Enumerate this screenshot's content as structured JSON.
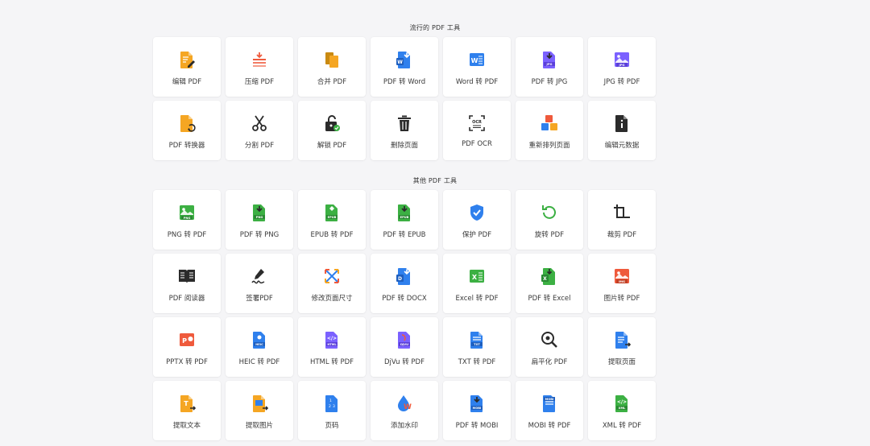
{
  "popular": {
    "title": "流行的 PDF 工具",
    "tools": [
      {
        "label": "编辑 PDF",
        "icon": "edit-pdf-icon"
      },
      {
        "label": "压缩 PDF",
        "icon": "compress-icon"
      },
      {
        "label": "合并 PDF",
        "icon": "merge-icon"
      },
      {
        "label": "PDF 转 Word",
        "icon": "word-download-icon"
      },
      {
        "label": "Word 转 PDF",
        "icon": "word-doc-icon"
      },
      {
        "label": "PDF 转 JPG",
        "icon": "jpg-download-icon"
      },
      {
        "label": "JPG 转 PDF",
        "icon": "jpg-image-icon"
      },
      {
        "label": "PDF 转换器",
        "icon": "convert-icon"
      },
      {
        "label": "分割 PDF",
        "icon": "scissors-icon"
      },
      {
        "label": "解锁 PDF",
        "icon": "unlock-icon"
      },
      {
        "label": "删除页面",
        "icon": "trash-icon"
      },
      {
        "label": "PDF OCR",
        "icon": "ocr-icon"
      },
      {
        "label": "重新排列页面",
        "icon": "rearrange-icon"
      },
      {
        "label": "编辑元数据",
        "icon": "info-file-icon"
      }
    ]
  },
  "other": {
    "title": "其他 PDF 工具",
    "tools": [
      {
        "label": "PNG 转 PDF",
        "icon": "png-image-icon"
      },
      {
        "label": "PDF 转 PNG",
        "icon": "png-download-icon"
      },
      {
        "label": "EPUB 转 PDF",
        "icon": "epub-icon"
      },
      {
        "label": "PDF 转 EPUB",
        "icon": "epub-download-icon"
      },
      {
        "label": "保护 PDF",
        "icon": "shield-check-icon"
      },
      {
        "label": "旋转 PDF",
        "icon": "rotate-icon"
      },
      {
        "label": "裁剪 PDF",
        "icon": "crop-icon"
      },
      {
        "label": "PDF 阅读器",
        "icon": "book-icon"
      },
      {
        "label": "签署PDF",
        "icon": "signature-icon"
      },
      {
        "label": "修改页面尺寸",
        "icon": "resize-arrows-icon"
      },
      {
        "label": "PDF 转 DOCX",
        "icon": "docx-download-icon"
      },
      {
        "label": "Excel 转 PDF",
        "icon": "excel-icon"
      },
      {
        "label": "PDF 转 Excel",
        "icon": "excel-download-icon"
      },
      {
        "label": "图片转 PDF",
        "icon": "img-icon"
      },
      {
        "label": "PPTX 转 PDF",
        "icon": "pptx-icon"
      },
      {
        "label": "HEIC 转 PDF",
        "icon": "heic-icon"
      },
      {
        "label": "HTML 转 PDF",
        "icon": "html-icon"
      },
      {
        "label": "DjVu 转 PDF",
        "icon": "djvu-icon"
      },
      {
        "label": "TXT 转 PDF",
        "icon": "txt-icon"
      },
      {
        "label": "扁平化 PDF",
        "icon": "flatten-eye-icon"
      },
      {
        "label": "提取页面",
        "icon": "extract-pages-icon"
      },
      {
        "label": "提取文本",
        "icon": "extract-text-icon"
      },
      {
        "label": "提取图片",
        "icon": "extract-image-icon"
      },
      {
        "label": "页码",
        "icon": "page-numbers-icon"
      },
      {
        "label": "添加水印",
        "icon": "watermark-icon"
      },
      {
        "label": "PDF 转 MOBI",
        "icon": "mobi-download-icon"
      },
      {
        "label": "MOBI 转 PDF",
        "icon": "mobi-icon"
      },
      {
        "label": "XML 转 PDF",
        "icon": "xml-icon"
      }
    ]
  },
  "colors": {
    "background": "#f5f5f7",
    "tile": "#ffffff",
    "orange": "#f5a623",
    "red": "#ef5a3c",
    "blue": "#2f80ed",
    "purple": "#7b61ff",
    "green": "#3cb043",
    "dark": "#2b2b2b"
  }
}
